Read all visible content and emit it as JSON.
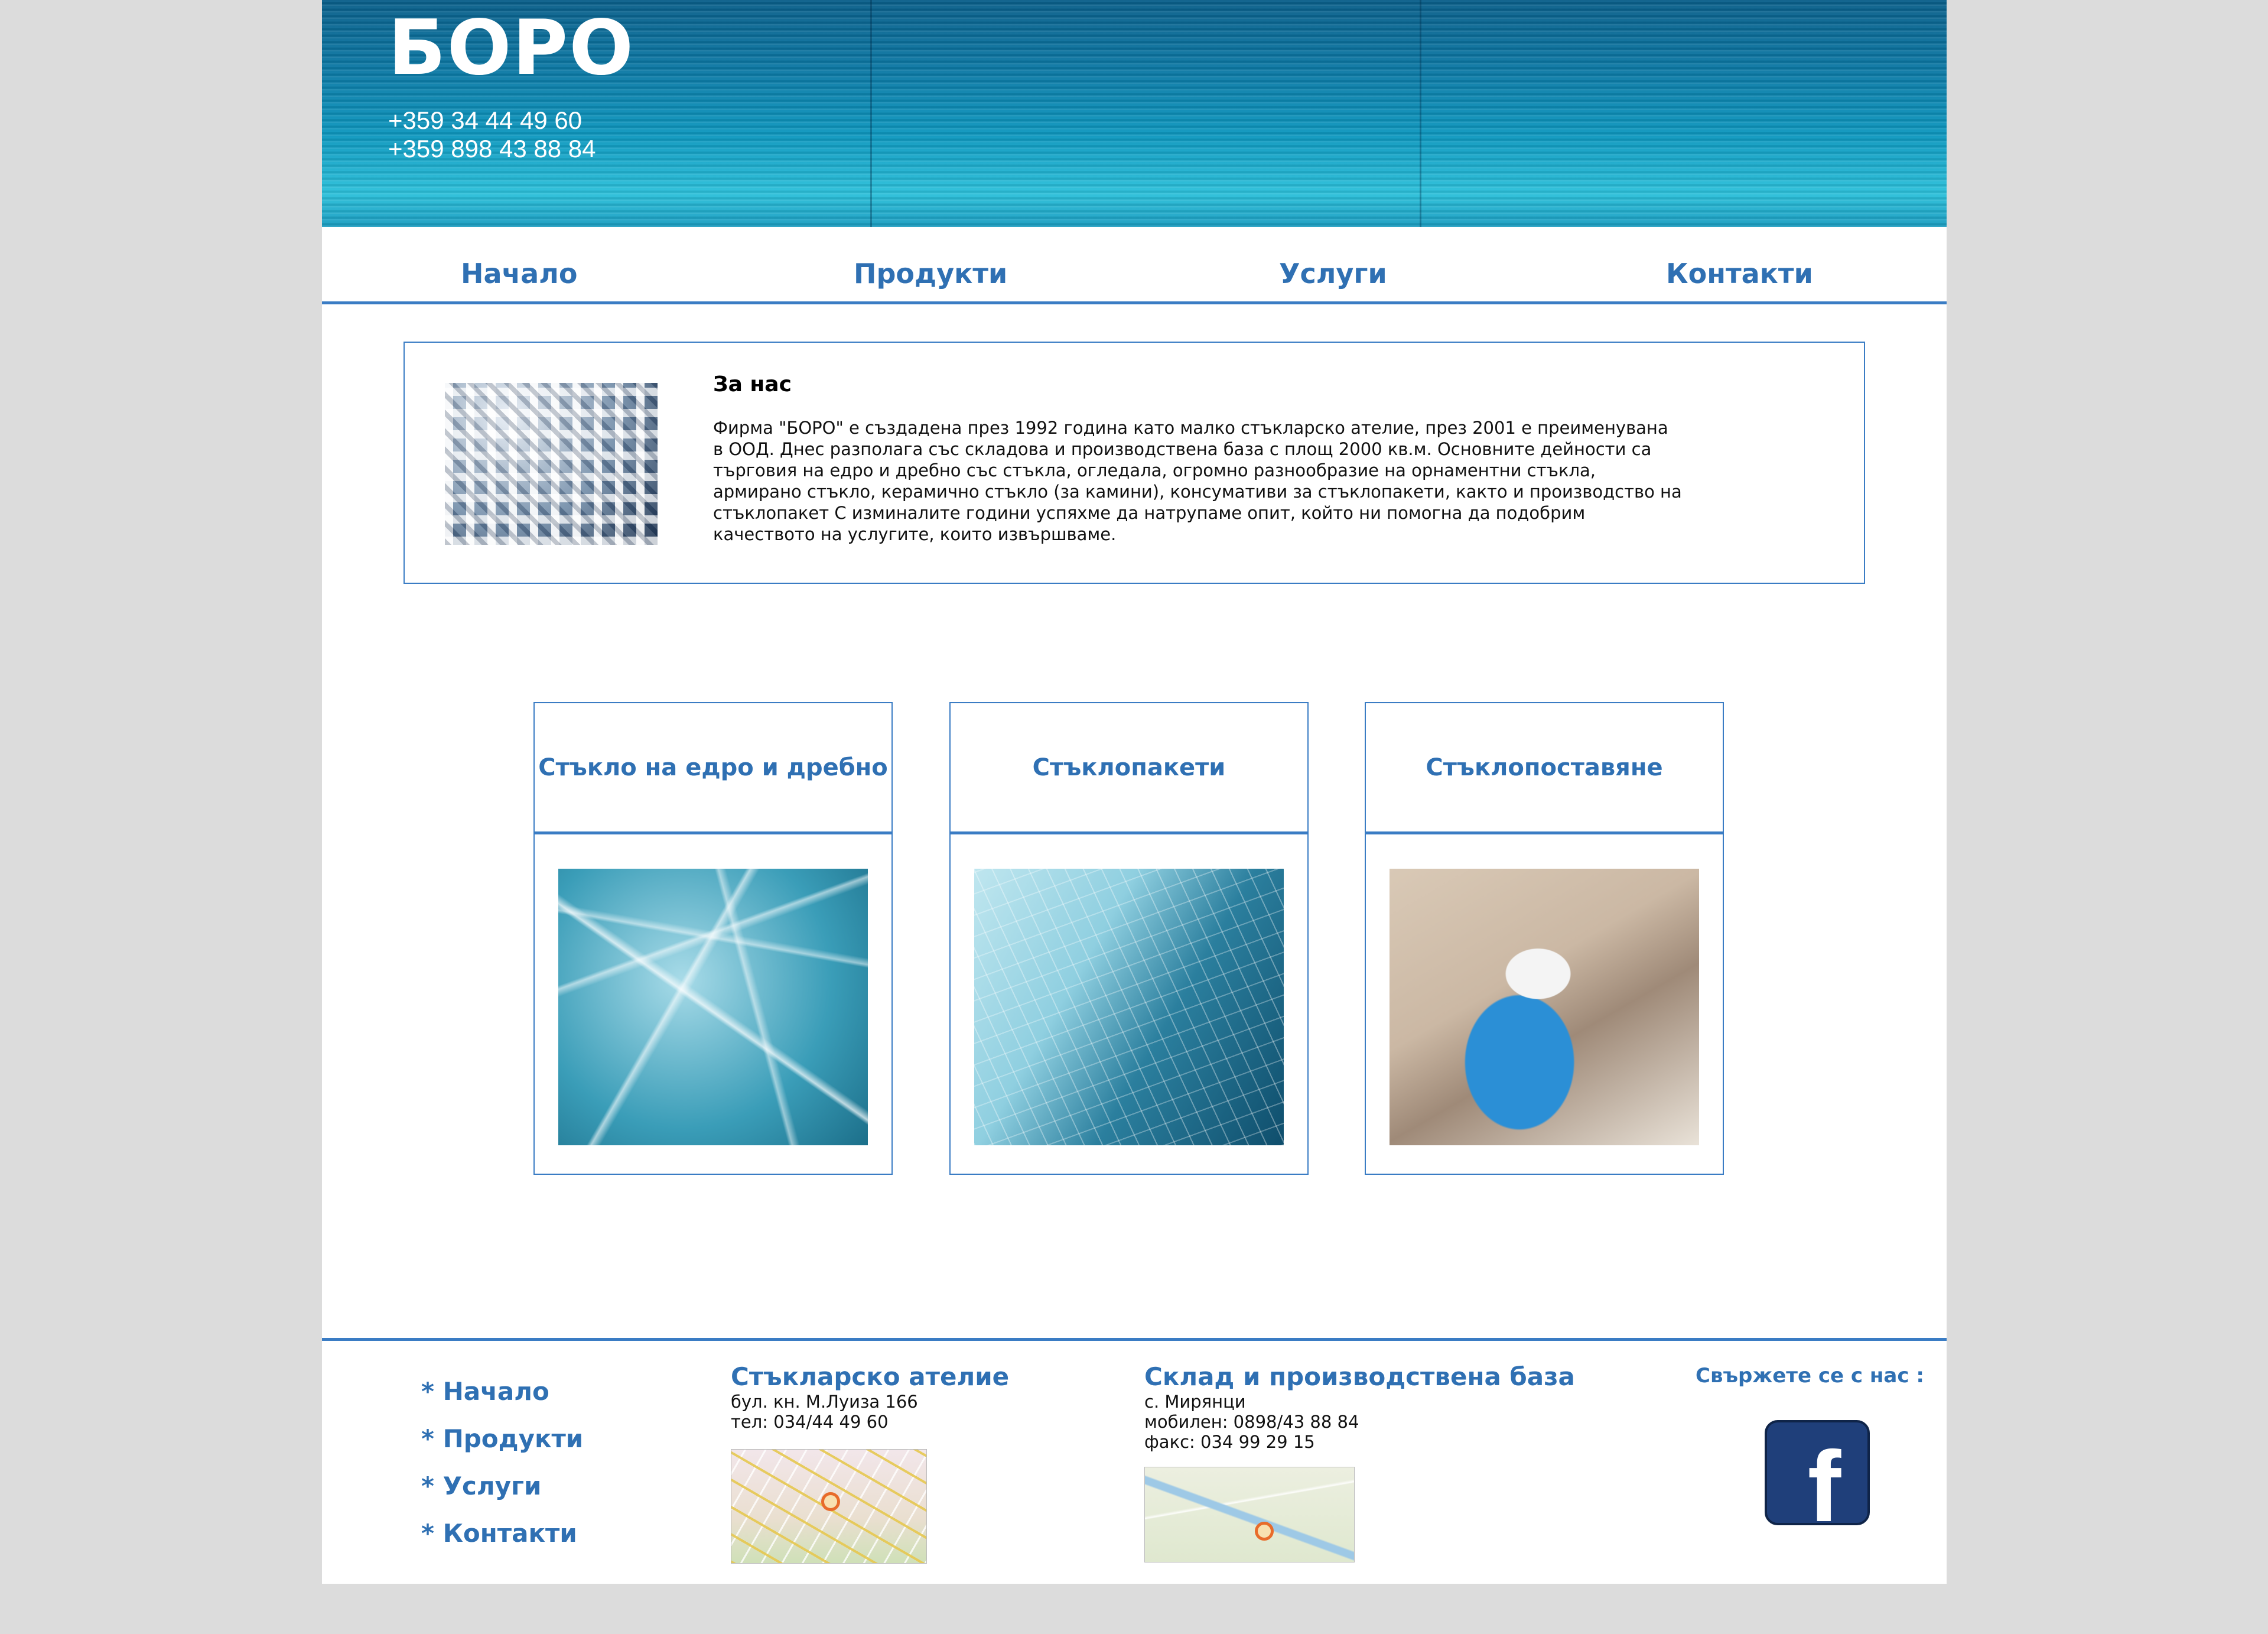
{
  "header": {
    "logo": "БОРО",
    "phones": [
      "+359 34 44 49 60",
      "+359 898 43 88 84"
    ]
  },
  "nav": {
    "items": [
      "Начало",
      "Продукти",
      "Услуги",
      "Контакти"
    ]
  },
  "about": {
    "title": "За нас",
    "text": "Фирма \"БОРО\" е създадена през 1992 година като малко стъкларско ателие, през 2001 е преименувана в ООД. Днес разполага със складова и производствена база с площ 2000 кв.м. Основните дейности са търговия на едро и дребно със стъкла, огледала, огромно разнообразие на орнаментни стъкла, армирано стъкло, керамично стъкло (за камини), консумативи за стъклопакети, както и производство на стъклопакет С изминалите години успяхме да натрупаме опит, който ни помогна да подобрим качеството на услугите, които извършваме."
  },
  "cards": [
    {
      "title": "Стъкло на едро и дребно",
      "image": "broken-glass-image"
    },
    {
      "title": "Стъклопакети",
      "image": "glass-building-image"
    },
    {
      "title": "Стъклопоставяне",
      "image": "glass-installer-image"
    }
  ],
  "footer": {
    "links": [
      "* Начало",
      "* Продукти",
      "* Услуги",
      "* Контакти"
    ],
    "atelier": {
      "title": "Стъкларско ателие",
      "lines": [
        "бул. кн. М.Луиза 166",
        "тел: 034/44 49 60"
      ]
    },
    "warehouse": {
      "title": "Склад и производствена база",
      "lines": [
        "с. Мирянци",
        "мобилен: 0898/43 88 84",
        "факс: 034 99 29 15"
      ]
    },
    "contact_title": "Свържете се с нас :",
    "facebook_glyph": "f"
  },
  "colors": {
    "accent": "#2f70b3",
    "border": "#3a7cc4",
    "background": "#dcdcdc"
  }
}
